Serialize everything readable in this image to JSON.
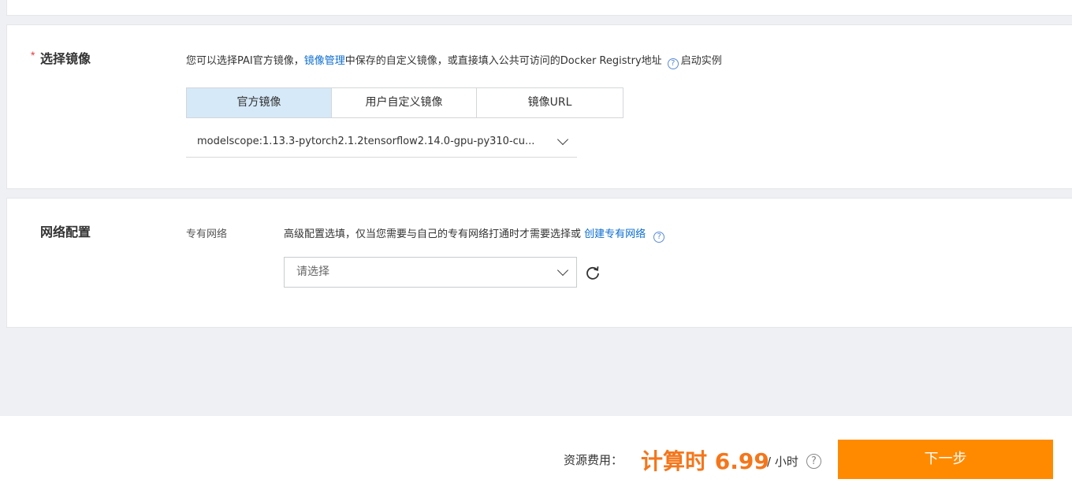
{
  "image_section": {
    "required_mark": "*",
    "title": "选择镜像",
    "desc_prefix": "您可以选择PAI官方镜像，",
    "desc_link": "镜像管理",
    "desc_suffix": "中保存的自定义镜像，或直接填入公共可访问的Docker Registry地址",
    "help_glyph": "?",
    "desc_tail": "启动实例",
    "tabs": [
      {
        "label": "官方镜像",
        "active": true
      },
      {
        "label": "用户自定义镜像",
        "active": false
      },
      {
        "label": "镜像URL",
        "active": false
      }
    ],
    "selected_image": "modelscope:1.13.3-pytorch2.1.2tensorflow2.14.0-gpu-py310-cu..."
  },
  "network_section": {
    "title": "网络配置",
    "label": "专有网络",
    "desc": "高级配置选填，仅当您需要与自己的专有网络打通时才需要选择或",
    "desc_link": "创建专有网络",
    "help_glyph": "?",
    "select_placeholder": "请选择"
  },
  "footer": {
    "cost_label": "资源费用：",
    "cost_value": "计算时 6.99",
    "cost_unit": "/ 小时",
    "help_glyph": "?",
    "next_button": "下一步"
  },
  "colors": {
    "accent_link": "#0a6dd1",
    "active_tab_bg": "#d6e9f8",
    "price_orange": "#f5761a",
    "button_orange": "#ff8a00"
  },
  "icons": [
    "help-icon",
    "chevron-down-icon",
    "refresh-icon"
  ]
}
